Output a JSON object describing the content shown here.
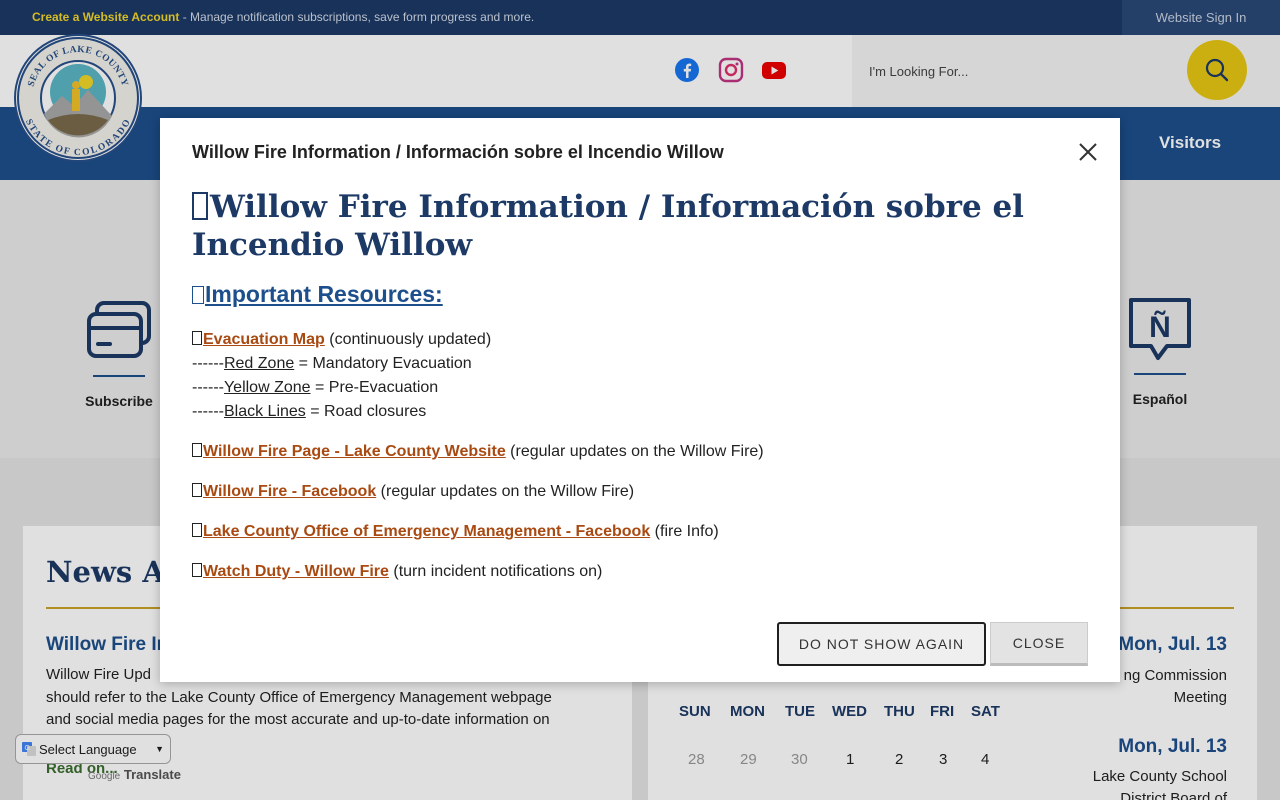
{
  "topbar": {
    "create_account": "Create a Website Account",
    "message": " - Manage notification subscriptions, save form progress and more.",
    "sign_in": "Website Sign In"
  },
  "header": {
    "seal_text_top": "SEAL OF LAKE COUNTY",
    "seal_text_bottom": "STATE OF COLORADO",
    "social": [
      "facebook-icon",
      "instagram-icon",
      "youtube-icon"
    ],
    "search_placeholder": "I'm Looking For..."
  },
  "nav": {
    "visible_item": "Visitors"
  },
  "quick_links": [
    {
      "label": "Subscribe",
      "icon": "credit-card-icon"
    },
    {
      "label": "Español",
      "icon": "speech-bubble-icon",
      "glyph": "Ñ"
    }
  ],
  "news": {
    "title": "News Ar",
    "item_title": "Willow Fire In",
    "lines": [
      "Willow Fire Upd",
      "should refer to the Lake County Office of Emergency Management webpage",
      "and social media pages for the most accurate and up-to-date information on"
    ],
    "read_on": "Read on..."
  },
  "calendar": {
    "weekdays": [
      "SUN",
      "MON",
      "TUE",
      "WED",
      "THU",
      "FRI",
      "SAT"
    ],
    "days": [
      "28",
      "29",
      "30",
      "1",
      "2",
      "3",
      "4"
    ],
    "muted_days": 3,
    "events": [
      {
        "date": "Mon, Jul. 13",
        "lines": [
          "ng Commission",
          "Meeting"
        ]
      },
      {
        "date": "Mon, Jul. 13",
        "lines": [
          "Lake County School",
          "District Board of"
        ]
      }
    ]
  },
  "translate": {
    "select_label": "Select Language",
    "powered_prefix": "Google",
    "powered": "Translate"
  },
  "modal": {
    "title": "Willow Fire Information / Información sobre el Incendio Willow",
    "heading": "Willow Fire Information / Información sobre el Incendio Willow",
    "resources_heading": "Important Resources:",
    "evac_link": "Evacuation Map",
    "evac_note": " (continuously updated)",
    "zones": [
      {
        "prefix": "------",
        "name": "Red Zone",
        "desc": " = Mandatory Evacuation"
      },
      {
        "prefix": "------",
        "name": "Yellow Zone",
        "desc": " = Pre-Evacuation"
      },
      {
        "prefix": "------",
        "name": "Black Lines",
        "desc": " = Road closures"
      }
    ],
    "links": [
      {
        "text": "Willow Fire Page - Lake County Website",
        "note": " (regular updates on the Willow Fire)"
      },
      {
        "text": "Willow Fire - Facebook",
        "note": " (regular updates on the Willow Fire)"
      },
      {
        "text": "Lake County Office of Emergency Management - Facebook",
        "note": " (fire Info)"
      },
      {
        "text": "Watch Duty - Willow Fire",
        "note": " (turn incident notifications on)"
      }
    ],
    "do_not_show": "DO NOT SHOW AGAIN",
    "close": "CLOSE"
  },
  "colors": {
    "navy": "#1d3a66",
    "nav_blue": "#1d4f8c",
    "gold": "#e8c813",
    "link_orange": "#a84a12"
  }
}
